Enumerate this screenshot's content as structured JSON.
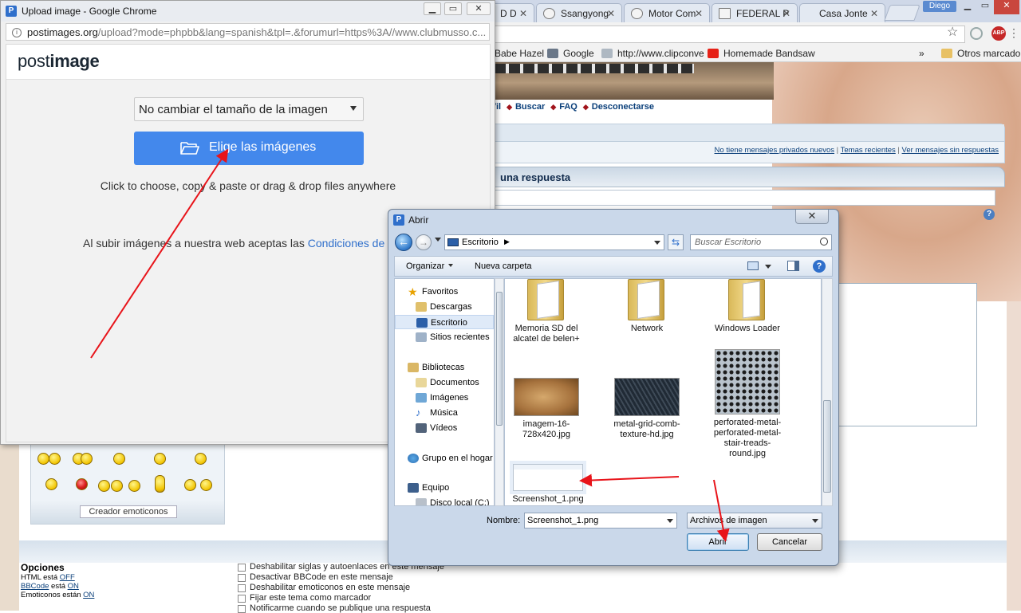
{
  "browser_bg": {
    "tabs": [
      {
        "label": "D D"
      },
      {
        "label": "Ssangyong"
      },
      {
        "label": "Motor Com"
      },
      {
        "label": "FEDERAL P"
      },
      {
        "label": "Casa Jonte"
      }
    ],
    "user": "Diego",
    "bookmarks": [
      "Babe Hazel",
      "Google",
      "http://www.clipconve",
      "Homemade Bandsaw"
    ],
    "other_bookmarks": "Otros marcadores",
    "overflow": "»"
  },
  "forum": {
    "nav": [
      "rfil",
      "Buscar",
      "FAQ",
      "Desconectarse"
    ],
    "links": [
      "No tiene mensajes privados nuevos",
      "Temas recientes",
      "Ver mensajes sin respuestas"
    ],
    "reply_heading": "una respuesta",
    "emoticon_creator": "Creador emoticonos",
    "options_title": "Opciones",
    "html_status": {
      "prefix": "HTML está",
      "value": "OFF"
    },
    "bbcode_status": {
      "name": "BBCode",
      "prefix": "está",
      "value": "ON"
    },
    "emoticons_status": {
      "prefix": "Emoticonos están",
      "value": "ON"
    },
    "checkboxes": [
      "Deshabilitar siglas y autoenlaces en este mensaje",
      "Desactivar BBCode en este mensaje",
      "Deshabilitar emoticonos en este mensaje",
      "Fijar este tema como marcador",
      "Notificarme cuando se publique una respuesta"
    ]
  },
  "popup": {
    "title": "Upload image - Google Chrome",
    "url_main": "postimages.org",
    "url_rest": "/upload?mode=phpbb&lang=spanish&tpl=.&forumurl=https%3A//www.clubmusso.c...",
    "logo_light": "post",
    "logo_bold": "image",
    "resize_option": "No cambiar el tamaño de la imagen",
    "choose_button": "Elige las imágenes",
    "hint": "Click to choose, copy & paste or drag & drop files anywhere",
    "terms_text": "Al subir imágenes a nuestra web aceptas las",
    "terms_link": "Condiciones de"
  },
  "dialog": {
    "title": "Abrir",
    "path": "Escritorio",
    "search_placeholder": "Buscar Escritorio",
    "organize": "Organizar",
    "new_folder": "Nueva carpeta",
    "nav": {
      "favorites": "Favoritos",
      "downloads": "Descargas",
      "desktop": "Escritorio",
      "recent": "Sitios recientes",
      "libraries": "Bibliotecas",
      "documents": "Documentos",
      "images": "Imágenes",
      "music": "Música",
      "videos": "Vídeos",
      "homegroup": "Grupo en el hogar",
      "computer": "Equipo",
      "local_disk": "Disco local (C:)"
    },
    "files": [
      {
        "name": "Memoria SD del alcatel de belen+"
      },
      {
        "name": "Network"
      },
      {
        "name": "Windows Loader"
      },
      {
        "name": "imagem-16-728x420.jpg"
      },
      {
        "name": "metal-grid-comb-texture-hd.jpg"
      },
      {
        "name": "perforated-metal-perforated-metal-stair-treads-round.jpg"
      },
      {
        "name": "Screenshot_1.png"
      }
    ],
    "name_label": "Nombre:",
    "name_value": "Screenshot_1.png",
    "filter": "Archivos de imagen",
    "open_button": "Abrir",
    "cancel_button": "Cancelar"
  },
  "colors": {
    "accent_blue": "#4388ec",
    "annotation_red": "#e8141a"
  }
}
